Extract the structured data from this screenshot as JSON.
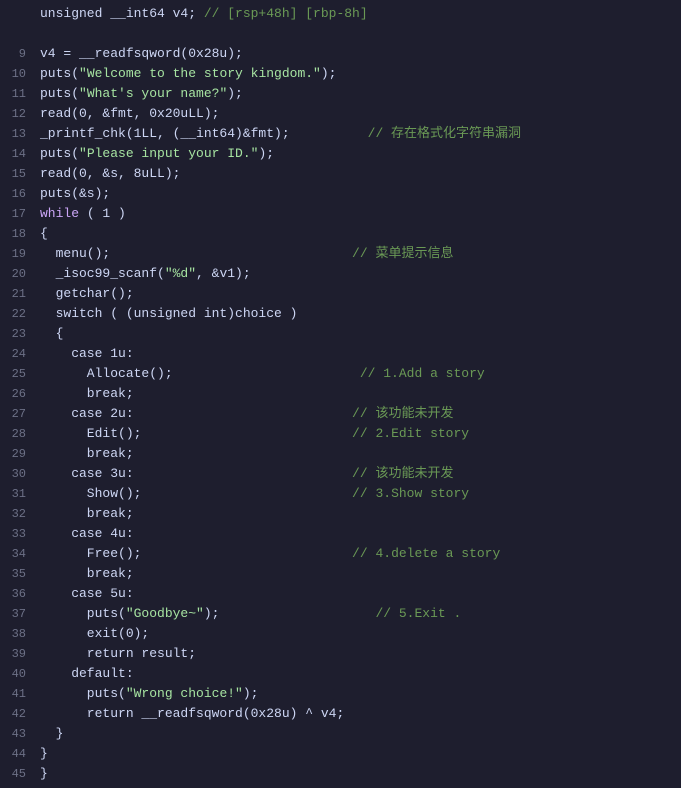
{
  "lines": [
    {
      "num": "",
      "tokens": [
        {
          "t": "unsigned __int64 v4; ",
          "c": "plain"
        },
        {
          "t": "// [rsp+48h] [rbp-8h]",
          "c": "comment"
        }
      ]
    },
    {
      "num": "",
      "tokens": []
    },
    {
      "num": "9",
      "tokens": [
        {
          "t": "v4 = __readfsqword(0x28u);",
          "c": "plain"
        }
      ]
    },
    {
      "num": "10",
      "tokens": [
        {
          "t": "puts(",
          "c": "plain"
        },
        {
          "t": "\"Welcome to the story kingdom.\"",
          "c": "str"
        },
        {
          "t": ");",
          "c": "plain"
        }
      ]
    },
    {
      "num": "11",
      "tokens": [
        {
          "t": "puts(",
          "c": "plain"
        },
        {
          "t": "\"What's your name?\"",
          "c": "str"
        },
        {
          "t": ");",
          "c": "plain"
        }
      ]
    },
    {
      "num": "12",
      "tokens": [
        {
          "t": "read(0, &fmt, 0x20uLL);",
          "c": "plain"
        }
      ]
    },
    {
      "num": "13",
      "tokens": [
        {
          "t": "_printf_chk(1LL, (__int64)&fmt);",
          "c": "plain"
        },
        {
          "t": "          // 存在格式化字符串漏洞",
          "c": "comment-cn"
        }
      ]
    },
    {
      "num": "14",
      "tokens": [
        {
          "t": "puts(",
          "c": "plain"
        },
        {
          "t": "\"Please input your ID.\"",
          "c": "str"
        },
        {
          "t": ");",
          "c": "plain"
        }
      ]
    },
    {
      "num": "15",
      "tokens": [
        {
          "t": "read(0, &s, 8uLL);",
          "c": "plain"
        }
      ]
    },
    {
      "num": "16",
      "tokens": [
        {
          "t": "puts(&s);",
          "c": "plain"
        }
      ]
    },
    {
      "num": "17",
      "tokens": [
        {
          "t": "while",
          "c": "kw"
        },
        {
          "t": " ( 1 )",
          "c": "plain"
        }
      ]
    },
    {
      "num": "18",
      "tokens": [
        {
          "t": "{",
          "c": "plain"
        }
      ]
    },
    {
      "num": "19",
      "tokens": [
        {
          "t": "  menu();",
          "c": "plain"
        },
        {
          "t": "                               // 菜单提示信息",
          "c": "comment-cn"
        }
      ]
    },
    {
      "num": "20",
      "tokens": [
        {
          "t": "  _isoc99_scanf(",
          "c": "plain"
        },
        {
          "t": "\"%d\"",
          "c": "str"
        },
        {
          "t": ", &v1);",
          "c": "plain"
        }
      ]
    },
    {
      "num": "21",
      "tokens": [
        {
          "t": "  getchar();",
          "c": "plain"
        }
      ]
    },
    {
      "num": "22",
      "tokens": [
        {
          "t": "  switch ( (unsigned int)choice )",
          "c": "plain"
        }
      ]
    },
    {
      "num": "23",
      "tokens": [
        {
          "t": "  {",
          "c": "plain"
        }
      ]
    },
    {
      "num": "24",
      "tokens": [
        {
          "t": "    case 1u:",
          "c": "plain"
        }
      ]
    },
    {
      "num": "25",
      "tokens": [
        {
          "t": "      Allocate();",
          "c": "plain"
        },
        {
          "t": "                        // 1.Add a story",
          "c": "comment"
        }
      ]
    },
    {
      "num": "26",
      "tokens": [
        {
          "t": "      break;",
          "c": "plain"
        }
      ]
    },
    {
      "num": "27",
      "tokens": [
        {
          "t": "    case 2u:",
          "c": "plain"
        },
        {
          "t": "                            // 该功能未开发",
          "c": "comment-cn"
        }
      ]
    },
    {
      "num": "28",
      "tokens": [
        {
          "t": "      Edit();",
          "c": "plain"
        },
        {
          "t": "                           // 2.Edit story",
          "c": "comment"
        }
      ]
    },
    {
      "num": "29",
      "tokens": [
        {
          "t": "      break;",
          "c": "plain"
        }
      ]
    },
    {
      "num": "30",
      "tokens": [
        {
          "t": "    case 3u:",
          "c": "plain"
        },
        {
          "t": "                            // 该功能未开发",
          "c": "comment-cn"
        }
      ]
    },
    {
      "num": "31",
      "tokens": [
        {
          "t": "      Show();",
          "c": "plain"
        },
        {
          "t": "                           // 3.Show story",
          "c": "comment"
        }
      ]
    },
    {
      "num": "32",
      "tokens": [
        {
          "t": "      break;",
          "c": "plain"
        }
      ]
    },
    {
      "num": "33",
      "tokens": [
        {
          "t": "    case 4u:",
          "c": "plain"
        }
      ]
    },
    {
      "num": "34",
      "tokens": [
        {
          "t": "      Free();",
          "c": "plain"
        },
        {
          "t": "                           // 4.delete a story",
          "c": "comment"
        }
      ]
    },
    {
      "num": "35",
      "tokens": [
        {
          "t": "      break;",
          "c": "plain"
        }
      ]
    },
    {
      "num": "36",
      "tokens": [
        {
          "t": "    case 5u:",
          "c": "plain"
        }
      ]
    },
    {
      "num": "37",
      "tokens": [
        {
          "t": "      puts(",
          "c": "plain"
        },
        {
          "t": "\"Goodbye~\"",
          "c": "str"
        },
        {
          "t": ");",
          "c": "plain"
        },
        {
          "t": "                    // 5.Exit .",
          "c": "comment"
        }
      ]
    },
    {
      "num": "38",
      "tokens": [
        {
          "t": "      exit(0);",
          "c": "plain"
        }
      ]
    },
    {
      "num": "39",
      "tokens": [
        {
          "t": "      return result;",
          "c": "plain"
        }
      ]
    },
    {
      "num": "40",
      "tokens": [
        {
          "t": "    default:",
          "c": "plain"
        }
      ]
    },
    {
      "num": "41",
      "tokens": [
        {
          "t": "      puts(",
          "c": "plain"
        },
        {
          "t": "\"Wrong choice!\"",
          "c": "str"
        },
        {
          "t": ");",
          "c": "plain"
        }
      ]
    },
    {
      "num": "42",
      "tokens": [
        {
          "t": "      return __readfsqword(0x28u) ^ v4;",
          "c": "plain"
        }
      ]
    },
    {
      "num": "43",
      "tokens": [
        {
          "t": "  }",
          "c": "plain"
        }
      ]
    },
    {
      "num": "44",
      "tokens": [
        {
          "t": "}",
          "c": "plain"
        }
      ]
    },
    {
      "num": "45",
      "tokens": [
        {
          "t": "}",
          "c": "plain"
        }
      ]
    }
  ]
}
